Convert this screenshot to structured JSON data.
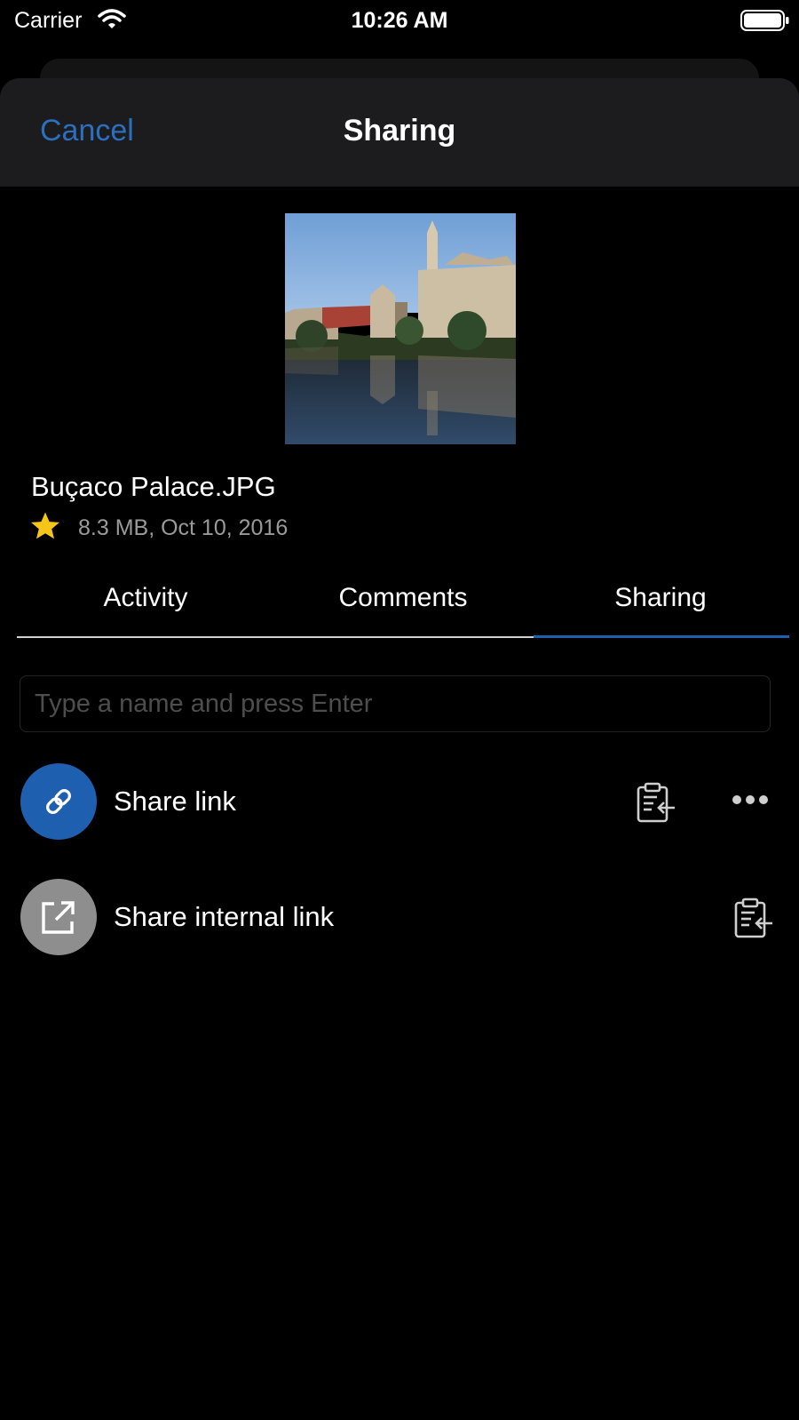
{
  "status_bar": {
    "carrier": "Carrier",
    "time": "10:26 AM"
  },
  "header": {
    "cancel_label": "Cancel",
    "title": "Sharing"
  },
  "file": {
    "name": "Buçaco Palace.JPG",
    "meta": "8.3 MB, Oct 10, 2016",
    "favorite": true
  },
  "tabs": [
    {
      "label": "Activity",
      "active": false
    },
    {
      "label": "Comments",
      "active": false
    },
    {
      "label": "Sharing",
      "active": true
    }
  ],
  "share_input": {
    "placeholder": "Type a name and press Enter",
    "value": ""
  },
  "share_options": [
    {
      "label": "Share link",
      "icon": "link-icon",
      "color": "#1f5fb0",
      "actions": [
        "copy-link-icon",
        "more-options-icon"
      ]
    },
    {
      "label": "Share internal link",
      "icon": "external-link-icon",
      "color": "#8e8e8e",
      "actions": [
        "copy-link-icon"
      ]
    }
  ],
  "colors": {
    "accent": "#2b6fbf",
    "star": "#f5c518",
    "background": "#000000",
    "header_background": "#1c1c1e"
  }
}
